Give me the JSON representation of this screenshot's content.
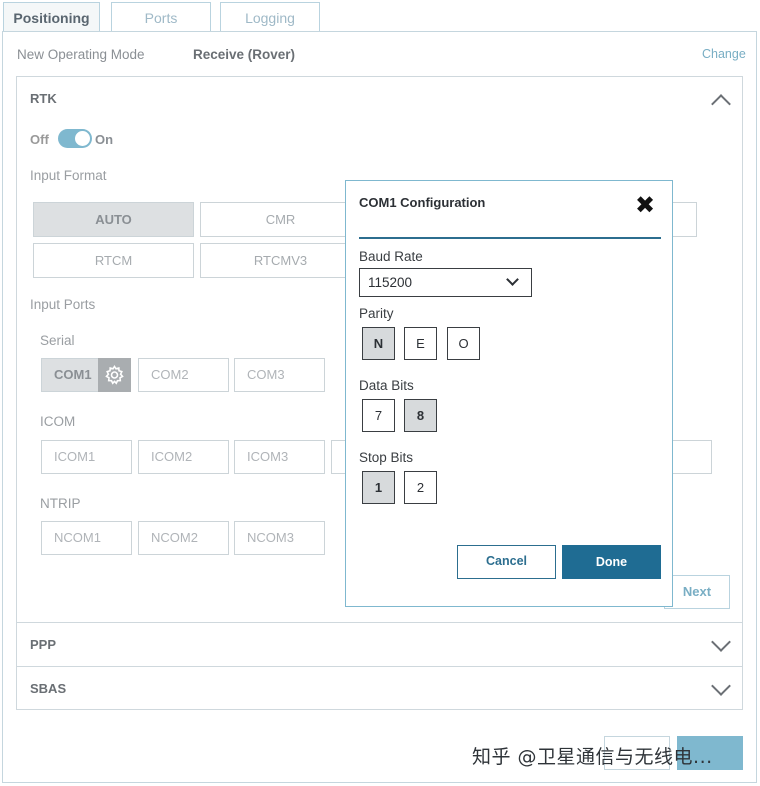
{
  "tabs": [
    {
      "label": "Positioning",
      "active": true
    },
    {
      "label": "Ports",
      "active": false
    },
    {
      "label": "Logging",
      "active": false
    }
  ],
  "mode": {
    "label": "New Operating Mode",
    "value": "Receive (Rover)",
    "change_link": "Change"
  },
  "rtk": {
    "title": "RTK",
    "toggle_off": "Off",
    "toggle_on": "On",
    "toggle_state": "on",
    "input_format_label": "Input Format",
    "formats": [
      {
        "label": "AUTO",
        "selected": true
      },
      {
        "label": "CMR",
        "selected": false
      },
      {
        "label": "RTCM",
        "selected": false
      },
      {
        "label": "RTCMV3",
        "selected": false
      }
    ],
    "input_ports_label": "Input Ports",
    "serial_label": "Serial",
    "serial_ports": [
      {
        "label": "COM1",
        "selected": true
      },
      {
        "label": "COM2",
        "selected": false
      },
      {
        "label": "COM3",
        "selected": false
      }
    ],
    "icom_label": "ICOM",
    "icom_ports": [
      "ICOM1",
      "ICOM2",
      "ICOM3"
    ],
    "ntrip_label": "NTRIP",
    "ntrip_ports": [
      "NCOM1",
      "NCOM2",
      "NCOM3"
    ],
    "next_label": "Next"
  },
  "ppp": {
    "title": "PPP"
  },
  "sbas": {
    "title": "SBAS"
  },
  "modal": {
    "title": "COM1 Configuration",
    "baud_label": "Baud Rate",
    "baud_value": "115200",
    "parity_label": "Parity",
    "parity_options": [
      {
        "label": "N",
        "selected": true
      },
      {
        "label": "E",
        "selected": false
      },
      {
        "label": "O",
        "selected": false
      }
    ],
    "data_bits_label": "Data Bits",
    "data_bits_options": [
      {
        "label": "7",
        "selected": false
      },
      {
        "label": "8",
        "selected": true
      }
    ],
    "stop_bits_label": "Stop Bits",
    "stop_bits_options": [
      {
        "label": "1",
        "selected": true
      },
      {
        "label": "2",
        "selected": false
      }
    ],
    "cancel_label": "Cancel",
    "done_label": "Done"
  },
  "watermark": "知乎 @卫星通信与无线电...",
  "colors": {
    "accent": "#7fb8cf",
    "primary_button": "#1f6c93",
    "selected_fill": "#dde0e2"
  }
}
